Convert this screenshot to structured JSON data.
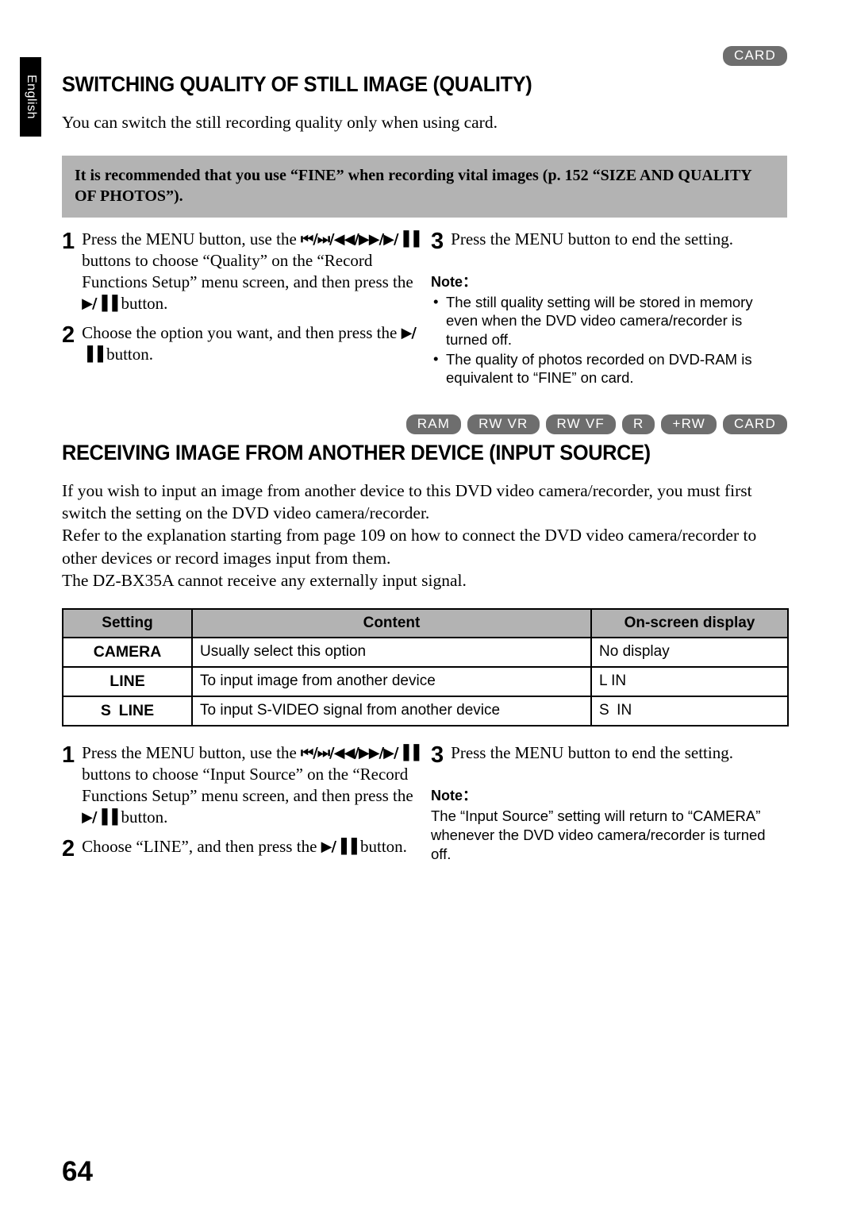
{
  "sidebar": {
    "language_tab": "English"
  },
  "section1": {
    "badges": [
      "CARD"
    ],
    "title": "SWITCHING QUALITY OF STILL IMAGE (QUALITY)",
    "lede": "You can switch the still recording quality only when using card.",
    "recommendation": "It is recommended that you use “FINE” when recording vital images (p. 152 “SIZE AND QUALITY OF PHOTOS”).",
    "steps": [
      {
        "num": "1",
        "text_1": "Press the MENU button, use the ",
        "keys_1": "⏮/⏭/",
        "keys_2": "◀◀/▶▶/▶/▐▐",
        "text_2": " buttons to choose “Quality” on the “Record Functions Setup” menu screen, and then press the ",
        "keys_3": "▶/▐▐",
        "text_3": " button."
      },
      {
        "num": "2",
        "text_1": "Choose the option you want, and then press the ",
        "keys_1": "▶/▐▐",
        "text_2": " button."
      },
      {
        "num": "3",
        "text_1": "Press the MENU button to end the setting."
      }
    ],
    "note_label": "Note：",
    "notes": [
      "The still quality setting will be stored in memory even when the DVD video camera/recorder is turned off.",
      "The quality of photos recorded on DVD-RAM is equivalent to “FINE” on card."
    ]
  },
  "section2": {
    "badges": [
      "RAM",
      "RW VR",
      "RW VF",
      "R",
      "+RW",
      "CARD"
    ],
    "title": "RECEIVING IMAGE FROM ANOTHER DEVICE (INPUT SOURCE)",
    "paragraphs": [
      "If you wish to input an image from another device to this DVD video camera/recorder, you must first switch the setting on the DVD video camera/recorder.",
      "Refer to the explanation starting from page 109 on how to connect the DVD video camera/recorder to other devices or record images input from them.",
      "The DZ-BX35A cannot receive any externally input signal."
    ],
    "table": {
      "headers": [
        "Setting",
        "Content",
        "On-screen display"
      ],
      "rows": [
        {
          "setting": "CAMERA",
          "content": "Usually select this option",
          "display": "No display"
        },
        {
          "setting": "LINE",
          "content": "To input image from another device",
          "display": "L IN"
        },
        {
          "setting": "S LINE",
          "content": "To input S-VIDEO signal from another device",
          "display": "S IN"
        }
      ]
    },
    "steps": [
      {
        "num": "1",
        "text_1": "Press the MENU button, use the ",
        "keys_1": "⏮/⏭/",
        "keys_2": "◀◀/▶▶/▶/▐▐",
        "text_2": " buttons to choose “Input Source” on the “Record Functions Setup” menu screen, and then press the ",
        "keys_3": "▶/▐▐",
        "text_3": " button."
      },
      {
        "num": "2",
        "text_1": "Choose “LINE”, and then press the ",
        "keys_1": "▶/▐▐",
        "text_2": " button."
      },
      {
        "num": "3",
        "text_1": "Press the MENU button to end the setting."
      }
    ],
    "note_label": "Note：",
    "note_text": "The “Input Source” setting will return to “CAMERA” whenever the DVD video camera/recorder is turned off."
  },
  "footer": {
    "page_number": "64"
  },
  "colors": {
    "badge_gray": "#6e6e6e",
    "panel_gray": "#b3b3b3",
    "tab_black": "#000000"
  }
}
